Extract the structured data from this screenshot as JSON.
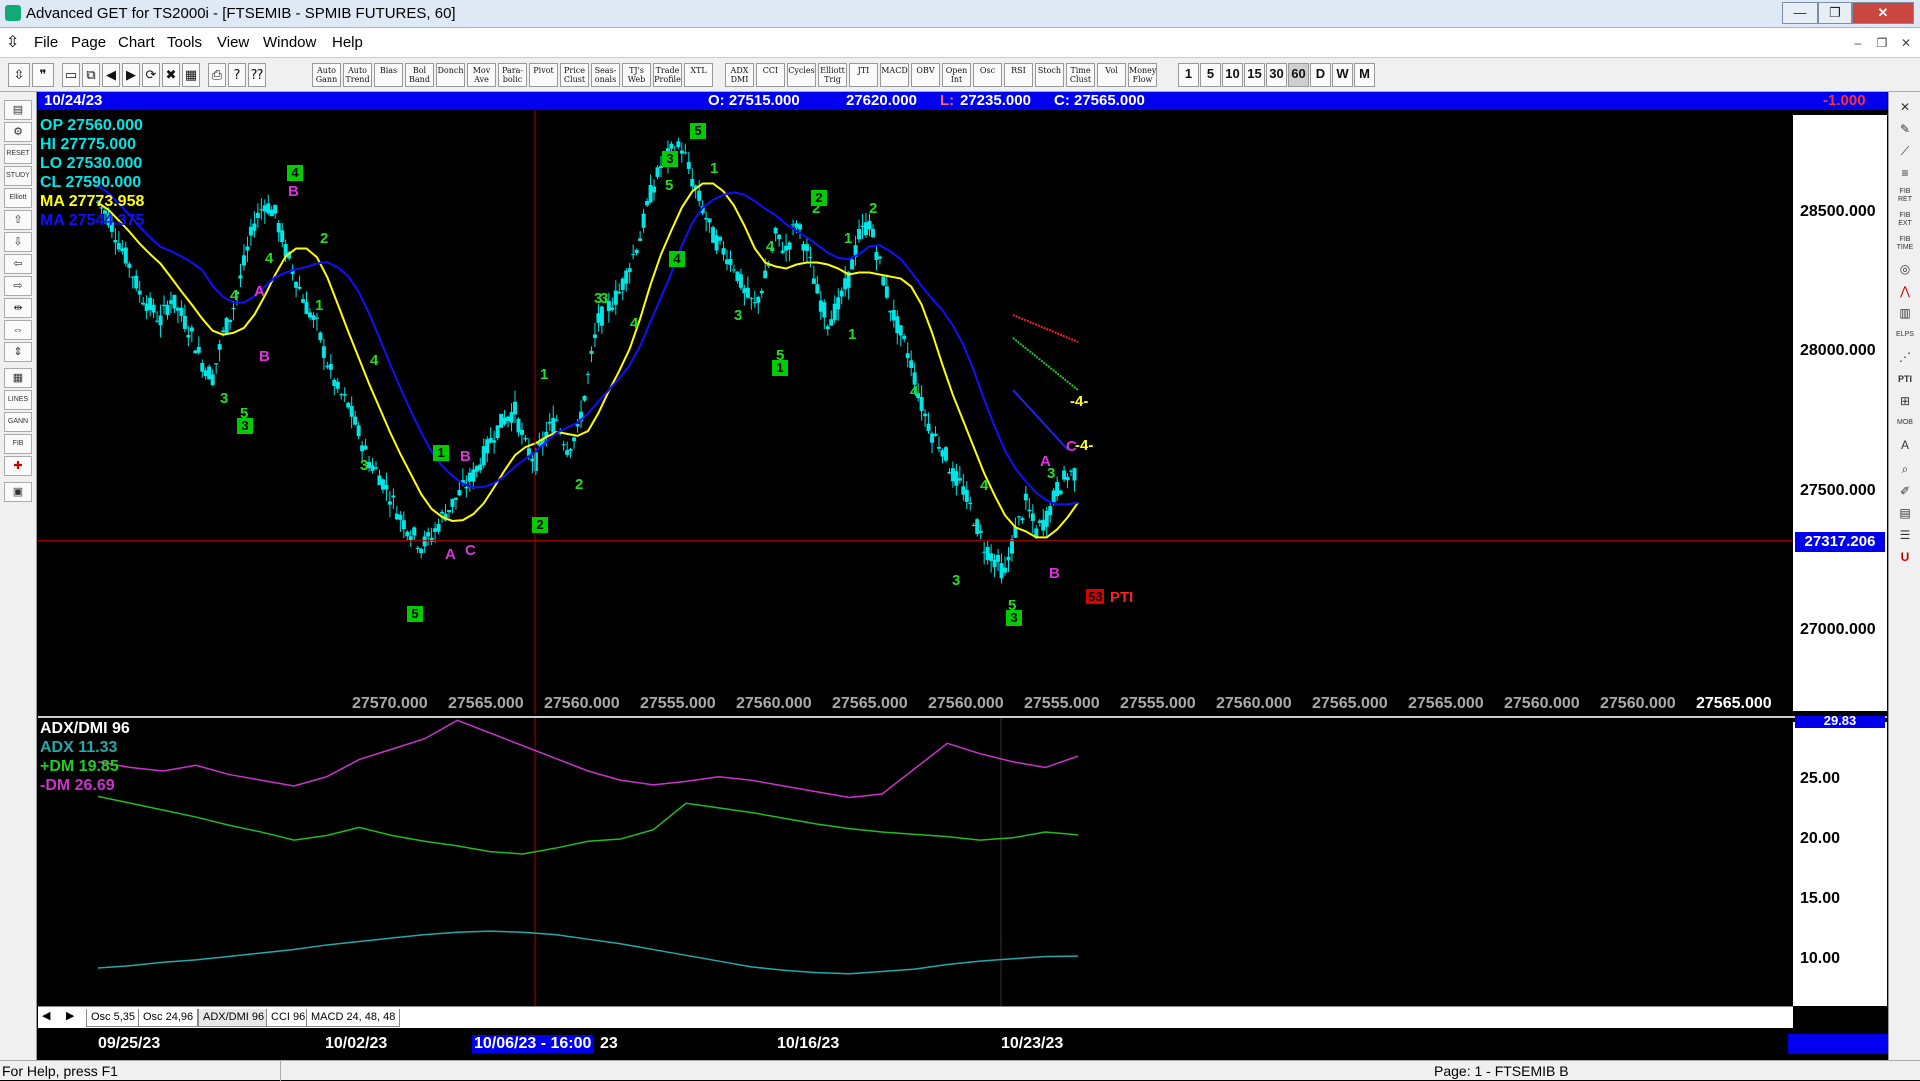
{
  "window": {
    "title": "Advanced GET for TS2000i - [FTSEMIB - SPMIB FUTURES, 60]",
    "min": "—",
    "max": "❐",
    "close": "✕",
    "mdi_min": "–",
    "mdi_restore": "❐",
    "mdi_close": "✕"
  },
  "menu": [
    "File",
    "Page",
    "Chart",
    "Tools",
    "View",
    "Window",
    "Help"
  ],
  "toolbar": {
    "studies": [
      "Auto Gann",
      "Auto Trend",
      "Bias",
      "Bol Band",
      "Donch",
      "Mov Ave",
      "Para-bolic",
      "Pivot",
      "Price Clust",
      "Seas-onals",
      "TJ's Web",
      "Trade Profile",
      "XTL",
      "ADX DMI",
      "CCI",
      "Cycles",
      "Elliott Trig",
      "JTI",
      "MACD",
      "OBV",
      "Open Int",
      "Osc",
      "RSI",
      "Stoch",
      "Time Clust",
      "Vol",
      "Money Flow"
    ],
    "periods": [
      "1",
      "5",
      "10",
      "15",
      "30",
      "60",
      "D",
      "W",
      "M"
    ],
    "selected_period": "60"
  },
  "infobar": {
    "date": "10/24/23",
    "open": "O: 27515.000",
    "high": "27620.000",
    "low_label": "L:",
    "low": "27235.000",
    "close": "C: 27565.000",
    "change": "-1.000"
  },
  "stats": {
    "op": "OP  27560.000",
    "hi": "HI   27775.000",
    "lo": "LO   27530.000",
    "cl": "CL  27590.000",
    "ma1": "MA  27773.958",
    "ma2": "MA  27544.375"
  },
  "price_axis": {
    "labels": [
      "28500.000",
      "28000.000",
      "27500.000",
      "27000.000"
    ],
    "crosshair_value": "27317.206"
  },
  "x_readouts": [
    "27570.000",
    "27565.000",
    "27560.000",
    "27555.000",
    "27560.000",
    "27565.000",
    "27560.000",
    "27555.000",
    "27555.000",
    "27560.000",
    "27565.000",
    "27565.000",
    "27560.000",
    "27560.000",
    "27565.000"
  ],
  "wave_labels": {
    "green": [
      "4",
      "2",
      "1",
      "4",
      "3",
      "3",
      "5",
      "4",
      "3",
      "4",
      "1",
      "2",
      "3",
      "5",
      "1",
      "3",
      "4",
      "2",
      "1",
      "5",
      "2",
      "4",
      "1",
      "3",
      "4",
      "5",
      "3"
    ],
    "green_boxed": [
      "4",
      "3",
      "1",
      "5",
      "2",
      "5",
      "3",
      "4",
      "2",
      "1",
      "3"
    ],
    "magenta": [
      "B",
      "A",
      "B",
      "B",
      "A",
      "C",
      "A",
      "B",
      "C"
    ],
    "yellow": [
      "-4-",
      "-4-"
    ]
  },
  "pti": {
    "value": "53",
    "label": "PTI"
  },
  "adx": {
    "title": "ADX/DMI 96",
    "adx": "ADX 11.33",
    "pdm": "+DM 19.85",
    "mdm": "-DM  26.69",
    "axis_labels": [
      "29.83",
      "25.00",
      "20.00",
      "15.00",
      "10.00"
    ]
  },
  "tabs": [
    "Osc 5,35",
    "Osc 24,96",
    "ADX/DMI 96",
    "CCI 96",
    "MACD 24, 48, 48"
  ],
  "selected_tab": "ADX/DMI 96",
  "dates": {
    "d1": "09/25/23",
    "d2": "10/02/23",
    "cursor_a": "10/06/23 - 16:00",
    "cursor_b": "23",
    "d4": "10/16/23",
    "d5": "10/23/23"
  },
  "status": {
    "help": "For Help, press F1",
    "page": "Page: 1 - FTSEMIB B"
  },
  "colors": {
    "candle": "#00e5e5",
    "ma_fast": "#ffff00",
    "ma_slow": "#1010ff",
    "pdm": "#22bb22",
    "mdm": "#cc33cc",
    "adx": "#22aaaa",
    "crosshair": "#b00000",
    "info_bg": "#0000ee"
  },
  "chart_data": {
    "type": "candlestick",
    "ylim": [
      26700,
      28850
    ],
    "price_path": [
      28520,
      28470,
      28380,
      28300,
      28200,
      28150,
      28100,
      28180,
      28120,
      28050,
      27950,
      27900,
      28050,
      28150,
      28300,
      28450,
      28520,
      28480,
      28350,
      28250,
      28150,
      28080,
      27950,
      27850,
      27800,
      27700,
      27600,
      27550,
      27480,
      27400,
      27350,
      27300,
      27330,
      27400,
      27450,
      27500,
      27550,
      27620,
      27700,
      27750,
      27780,
      27650,
      27600,
      27700,
      27750,
      27650,
      27700,
      27900,
      28100,
      28150,
      28200,
      28300,
      28400,
      28550,
      28650,
      28700,
      28720,
      28600,
      28500,
      28400,
      28350,
      28300,
      28200,
      28150,
      28250,
      28400,
      28350,
      28450,
      28350,
      28200,
      28100,
      28150,
      28250,
      28400,
      28450,
      28300,
      28150,
      28050,
      27950,
      27800,
      27700,
      27650,
      27550,
      27500,
      27400,
      27300,
      27250,
      27200,
      27350,
      27450,
      27350,
      27400,
      27500,
      27550,
      27565
    ],
    "adx": [
      8.3,
      8.5,
      8.8,
      9.0,
      9.3,
      9.6,
      9.9,
      10.3,
      10.6,
      10.9,
      11.2,
      11.4,
      11.5,
      11.4,
      11.2,
      10.8,
      10.4,
      9.9,
      9.4,
      8.9,
      8.4,
      8.1,
      7.9,
      7.8,
      8.0,
      8.2,
      8.6,
      8.9,
      9.1,
      9.3,
      9.33
    ],
    "pdm": [
      23.2,
      22.6,
      22.0,
      21.4,
      20.7,
      20.1,
      19.4,
      19.8,
      20.5,
      19.8,
      19.3,
      18.9,
      18.4,
      18.2,
      18.7,
      19.3,
      19.5,
      20.3,
      22.6,
      22.2,
      21.8,
      21.3,
      20.8,
      20.4,
      20.1,
      19.9,
      19.7,
      19.4,
      19.6,
      20.1,
      19.85
    ],
    "mdm": [
      26.2,
      25.7,
      25.4,
      25.9,
      25.1,
      24.6,
      24.1,
      24.9,
      26.4,
      27.3,
      28.2,
      29.8,
      28.7,
      27.6,
      26.5,
      25.4,
      24.6,
      24.2,
      24.5,
      24.9,
      24.6,
      24.1,
      23.6,
      23.1,
      23.4,
      25.6,
      27.8,
      26.9,
      26.2,
      25.7,
      26.69
    ],
    "adx_ylim": [
      5,
      30
    ]
  }
}
